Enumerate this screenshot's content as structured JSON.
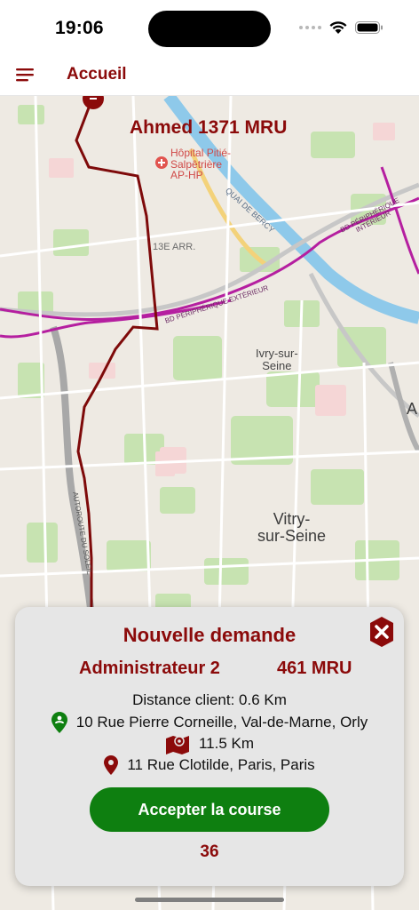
{
  "status_bar": {
    "time": "19:06"
  },
  "header": {
    "title": "Accueil"
  },
  "map": {
    "driver_label": "Ahmed 1371 MRU",
    "labels": {
      "hospital": "Hôpital Pitié-\nSalpêtrière\nAP-HP",
      "arrondissement": "13E ARR.",
      "ivry": "Ivry-sur-\nSeine",
      "vitry": "Vitry-\nsur-Seine",
      "quai": "QUAI DE BERCY",
      "bd_peripherique_1": "BD PÉRIPHÉRIQUE EXTÉRIEUR",
      "bd_peripherique_2": "BD PÉRIPHÉRIQUE INTÉRIEUR",
      "autoroute": "AUTOROUTE DU SOLEIL",
      "edge_letter": "A"
    }
  },
  "request": {
    "title": "Nouvelle demande",
    "client_name": "Administrateur 2",
    "price": "461 MRU",
    "distance_client": "Distance client: 0.6 Km",
    "pickup_address": "10 Rue Pierre Corneille, Val-de-Marne, Orly",
    "trip_distance": "11.5 Km",
    "dropoff_address": "11 Rue Clotilde, Paris, Paris",
    "accept_label": "Accepter la course",
    "countdown": "36"
  },
  "colors": {
    "brand": "#8b0a0a",
    "accept": "#0e7f10",
    "pickup_pin": "#0e7f10",
    "dropoff_pin": "#8b0a0a"
  }
}
